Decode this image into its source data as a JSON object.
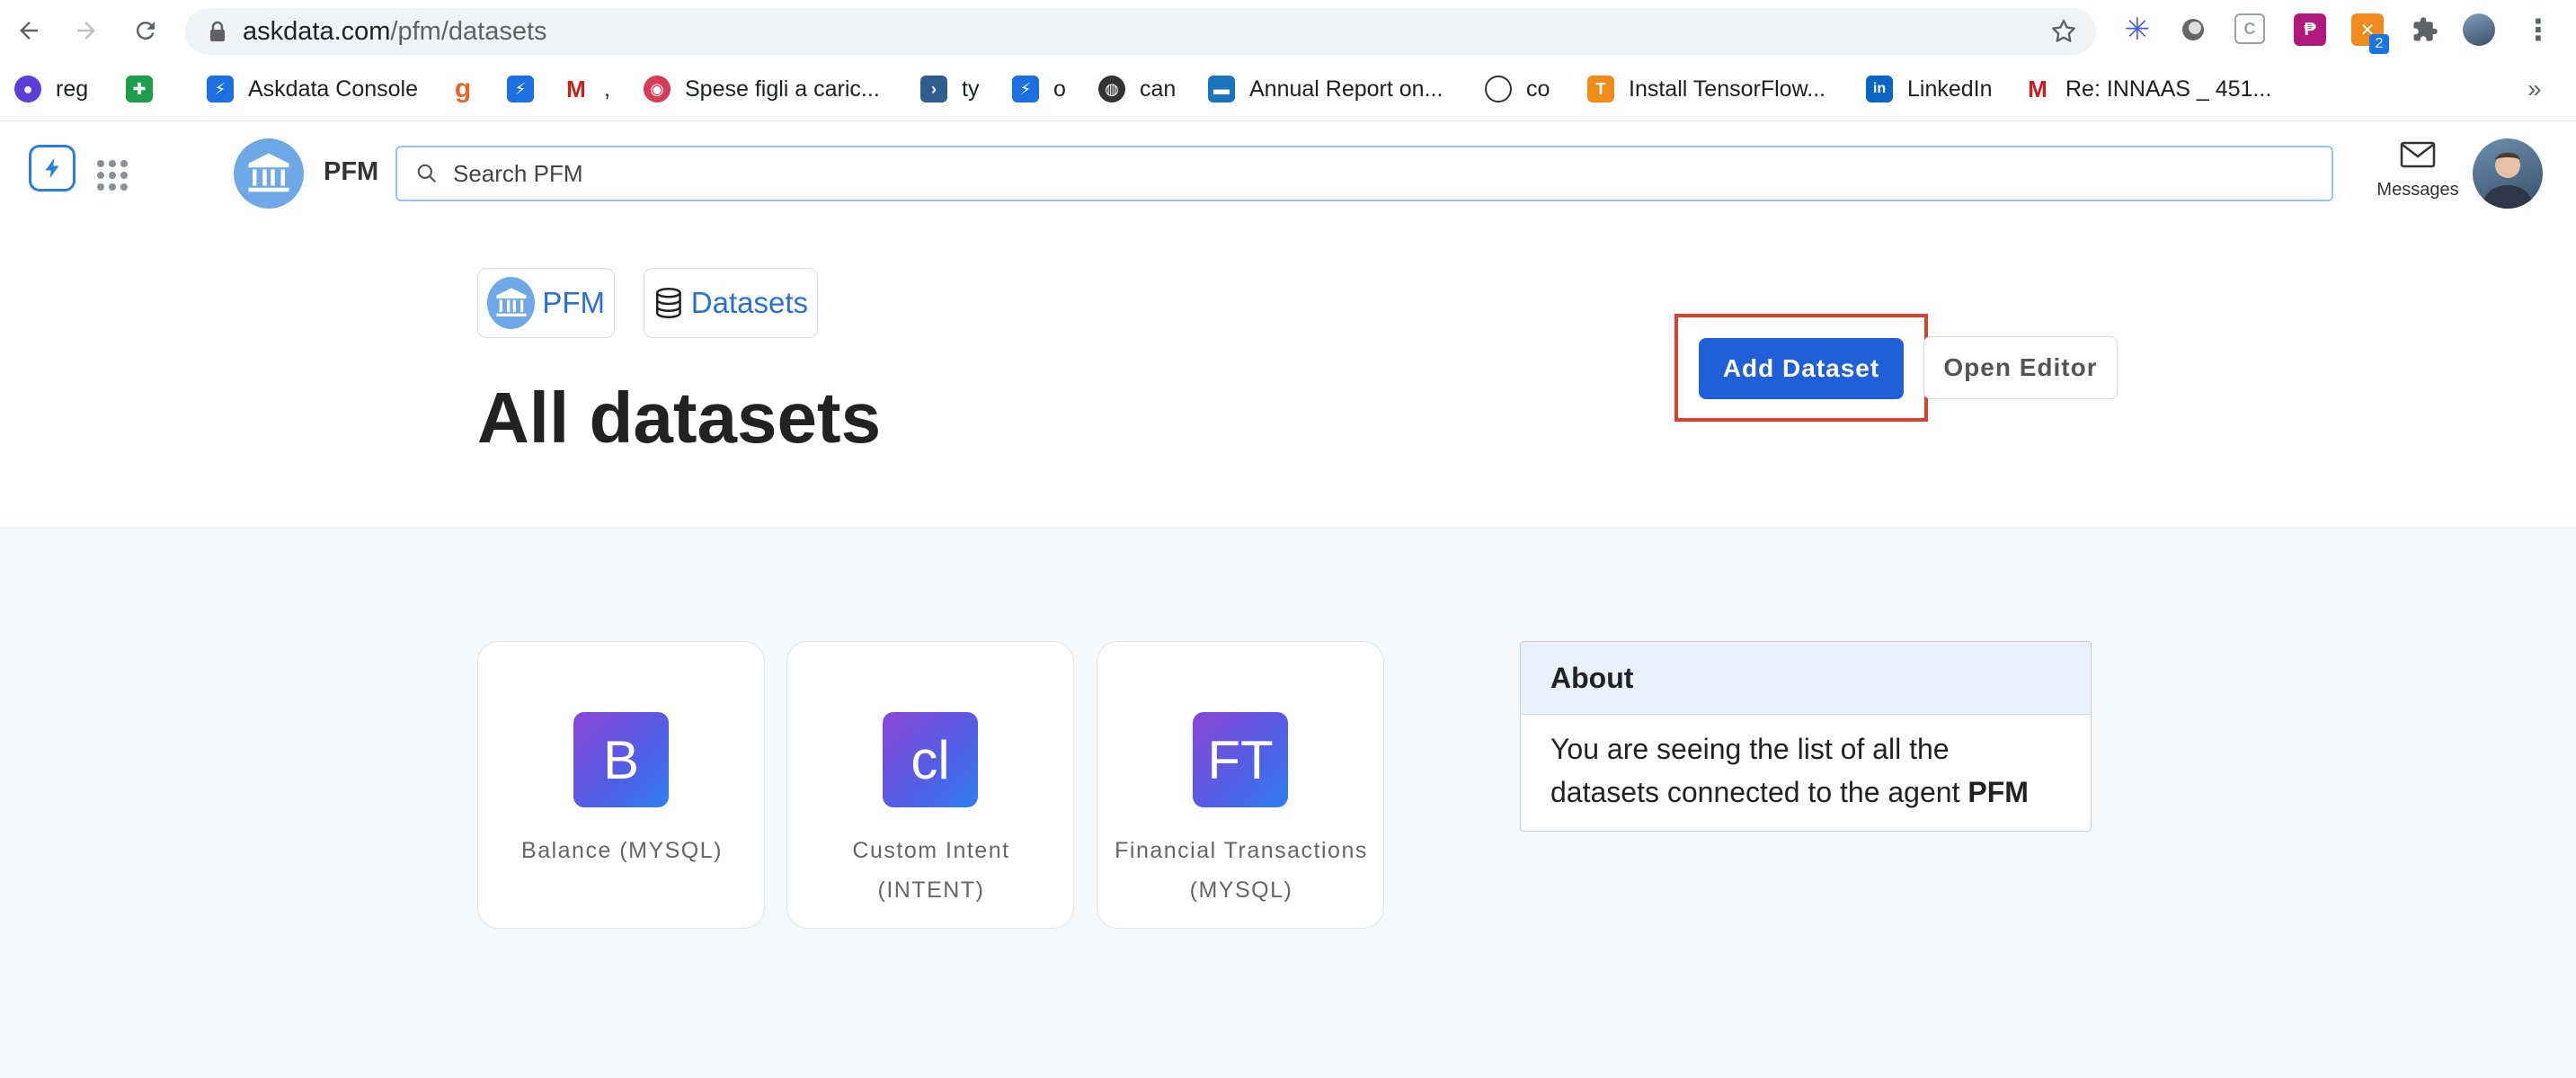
{
  "browser": {
    "url_host": "askdata.com",
    "url_path": "/pfm/datasets",
    "extension_badge": "2",
    "bookmarks_overflow": "»",
    "bookmarks": [
      {
        "label": "reg"
      },
      {
        "label": ""
      },
      {
        "label": "Askdata Console"
      },
      {
        "label": ""
      },
      {
        "label": ""
      },
      {
        "label": ","
      },
      {
        "label": "Spese figli a caric..."
      },
      {
        "label": "ty"
      },
      {
        "label": "o"
      },
      {
        "label": "can"
      },
      {
        "label": "Annual Report on..."
      },
      {
        "label": "co"
      },
      {
        "label": "Install TensorFlow..."
      },
      {
        "label": "LinkedIn"
      },
      {
        "label": "Re: INNAAS _ 451..."
      }
    ]
  },
  "header": {
    "agent_name": "PFM",
    "search_placeholder": "Search PFM",
    "messages_label": "Messages"
  },
  "breadcrumb": {
    "agent_label": "PFM",
    "section_label": "Datasets"
  },
  "page": {
    "title": "All datasets",
    "add_button": "Add Dataset",
    "editor_button": "Open Editor"
  },
  "datasets": [
    {
      "initials": "B",
      "name": "Balance (MYSQL)"
    },
    {
      "initials": "cl",
      "name": "Custom Intent (INTENT)"
    },
    {
      "initials": "FT",
      "name": "Financial Transactions (MYSQL)"
    }
  ],
  "about": {
    "title": "About",
    "text": "You are seeing the list of all the datasets connected to the agent ",
    "agent": "PFM"
  },
  "colors": {
    "accent": "#1f5fd8",
    "highlight": "#e0402b",
    "link": "#2a6fd6"
  }
}
